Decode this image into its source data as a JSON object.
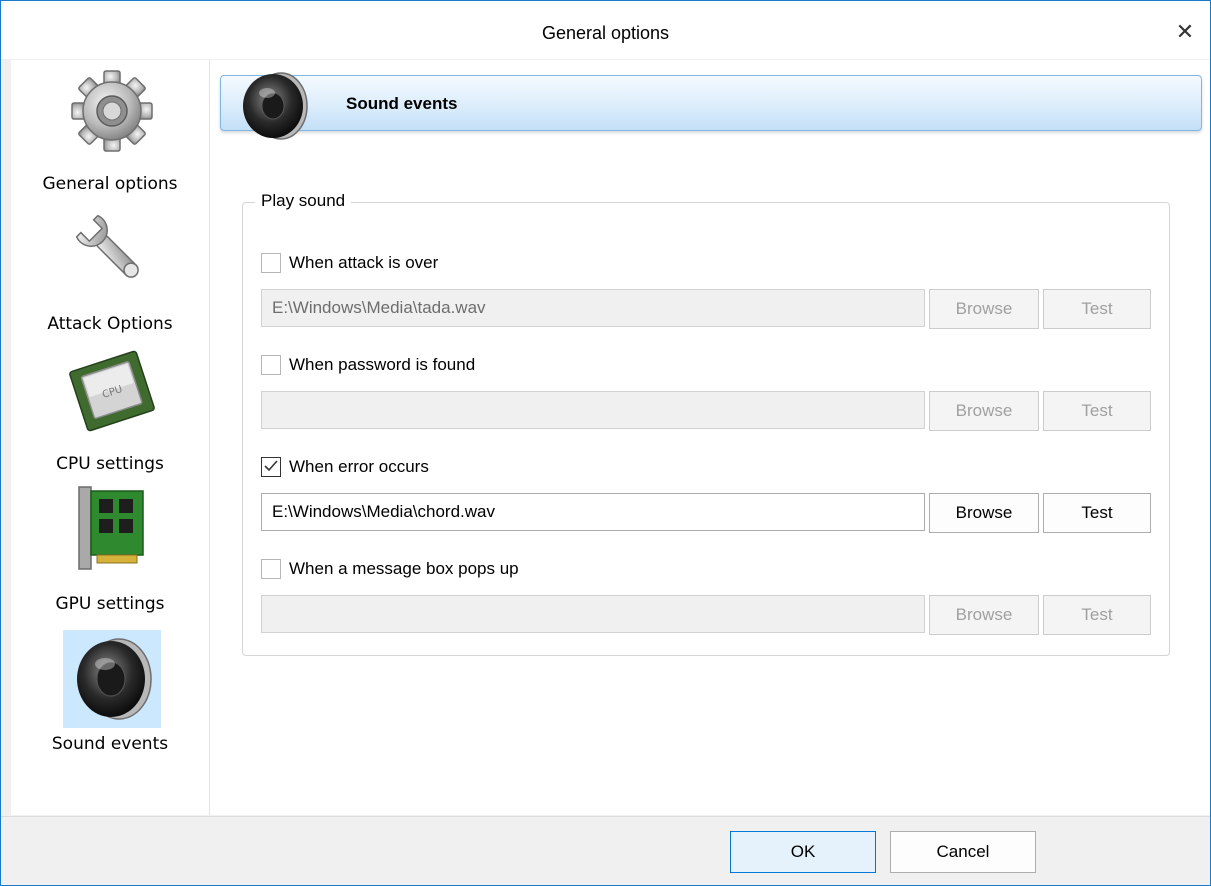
{
  "window": {
    "title": "General options",
    "close_glyph": "✕"
  },
  "sidebar": {
    "items": [
      {
        "label": "General options",
        "icon": "gear-icon",
        "selected": false
      },
      {
        "label": "Attack Options",
        "icon": "wrench-icon",
        "selected": false
      },
      {
        "label": "CPU settings",
        "icon": "cpu-chip-icon",
        "selected": false
      },
      {
        "label": "GPU settings",
        "icon": "gpu-card-icon",
        "selected": false
      },
      {
        "label": "Sound events",
        "icon": "speaker-icon",
        "selected": true
      }
    ]
  },
  "header": {
    "title": "Sound events",
    "icon": "speaker-icon"
  },
  "group": {
    "legend": "Play sound",
    "events": [
      {
        "label": "When attack is over",
        "checked": false,
        "path": "E:\\Windows\\Media\\tada.wav",
        "browse": "Browse",
        "test": "Test",
        "enabled": false
      },
      {
        "label": "When password is found",
        "checked": false,
        "path": "",
        "browse": "Browse",
        "test": "Test",
        "enabled": false
      },
      {
        "label": "When error occurs",
        "checked": true,
        "path": "E:\\Windows\\Media\\chord.wav",
        "browse": "Browse",
        "test": "Test",
        "enabled": true
      },
      {
        "label": "When a message box pops up",
        "checked": false,
        "path": "",
        "browse": "Browse",
        "test": "Test",
        "enabled": false
      }
    ]
  },
  "footer": {
    "ok_label": "OK",
    "cancel_label": "Cancel"
  },
  "colors": {
    "accent": "#0078d7",
    "selection": "#cce8ff",
    "header_gradient_bottom": "#c4e0f7"
  }
}
